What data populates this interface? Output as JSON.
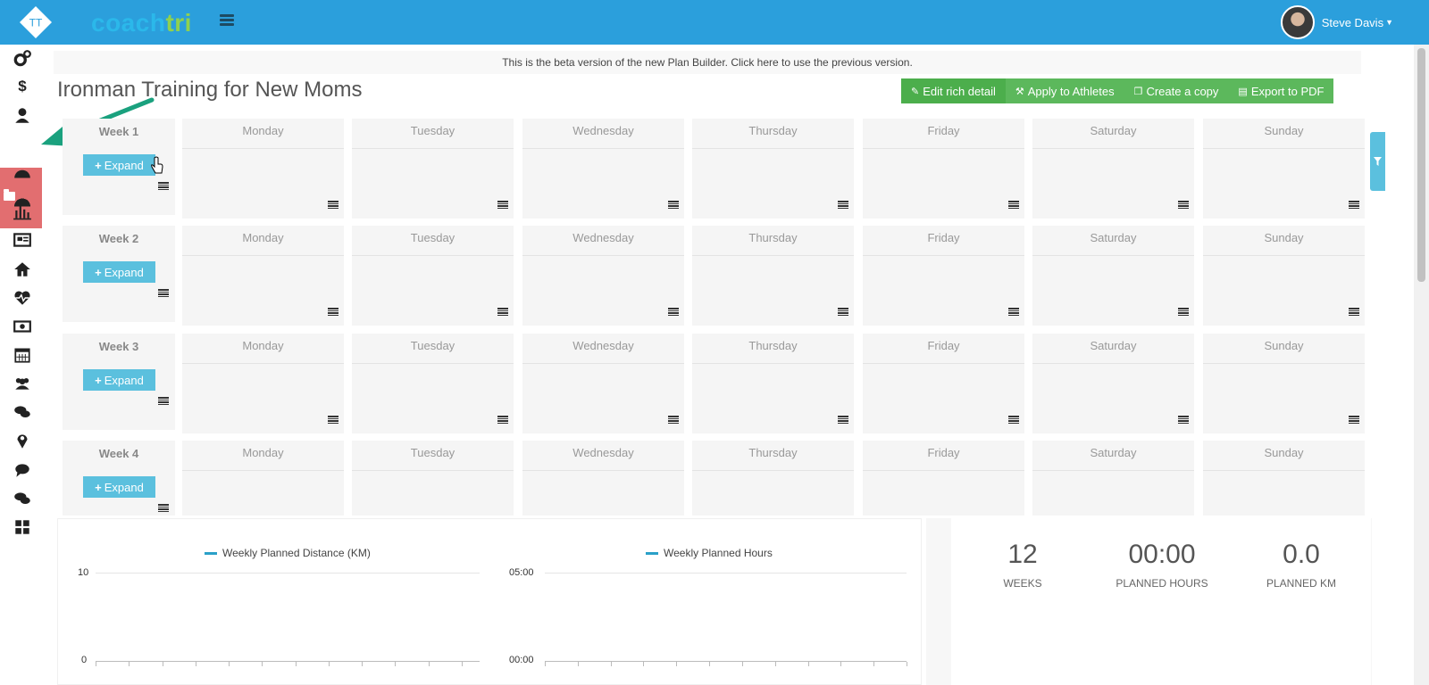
{
  "header": {
    "logo_text": "TT",
    "brand_part1": "coach",
    "brand_part2": "tri",
    "user_name": "Steve Davis"
  },
  "sidebar": {
    "icons": [
      "cogs-icon",
      "dollar-icon",
      "user-icon",
      "folder-icon",
      "dashboard-icon",
      "bar-chart-icon",
      "newspaper-icon",
      "home-icon",
      "heartbeat-icon",
      "money-icon",
      "calendar-icon",
      "users-icon",
      "comments-icon",
      "map-marker-icon",
      "comment-icon",
      "chat-icon",
      "th-large-icon"
    ]
  },
  "banner": "This is the beta version of the new Plan Builder. Click here to use the previous version.",
  "page_title": "Ironman Training for New Moms",
  "actions": [
    {
      "label": "Edit rich detail",
      "icon": "edit-icon"
    },
    {
      "label": "Apply to Athletes",
      "icon": "magic-icon"
    },
    {
      "label": "Create a copy",
      "icon": "copy-icon"
    },
    {
      "label": "Export to PDF",
      "icon": "pdf-icon"
    }
  ],
  "days": [
    "Monday",
    "Tuesday",
    "Wednesday",
    "Thursday",
    "Friday",
    "Saturday",
    "Sunday"
  ],
  "weeks": [
    {
      "label": "Week 1",
      "expand": "Expand"
    },
    {
      "label": "Week 2",
      "expand": "Expand"
    },
    {
      "label": "Week 3",
      "expand": "Expand"
    },
    {
      "label": "Week 4",
      "expand": "Expand"
    }
  ],
  "charts": {
    "distance": {
      "legend": "Weekly Planned Distance (KM)",
      "ymax": "10",
      "ymin": "0"
    },
    "hours": {
      "legend": "Weekly Planned Hours",
      "ymax": "05:00",
      "ymin": "00:00"
    }
  },
  "stats": [
    {
      "value": "12",
      "label": "WEEKS"
    },
    {
      "value": "00:00",
      "label": "PLANNED HOURS"
    },
    {
      "value": "0.0",
      "label": "PLANNED KM"
    }
  ],
  "colors": {
    "topbar": "#2b9fdc",
    "accent_green": "#5cb85c",
    "accent_info": "#5bc0de",
    "sidebar_active": "#e26e70",
    "arrow": "#1aa17e"
  }
}
